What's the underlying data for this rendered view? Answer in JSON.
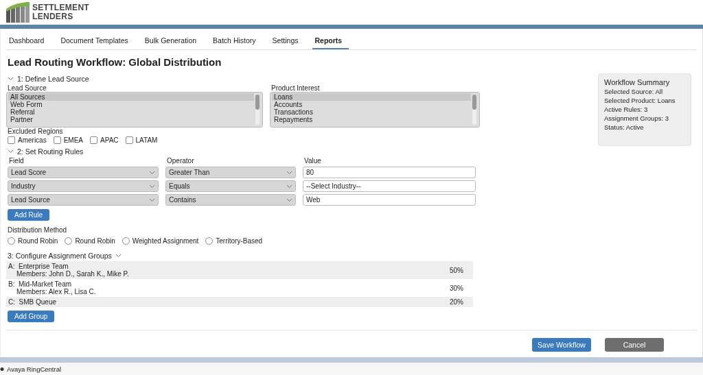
{
  "logo": {
    "line1": "SETTLEMENT",
    "line2": "LENDERS"
  },
  "tabs": [
    {
      "label": "Dashboard",
      "selected": false
    },
    {
      "label": "Document Templates",
      "selected": false
    },
    {
      "label": "Bulk Generation",
      "selected": false
    },
    {
      "label": "Batch History",
      "selected": false
    },
    {
      "label": "Settings",
      "selected": false
    },
    {
      "label": "Reports",
      "selected": true
    }
  ],
  "title": "Lead Routing Workflow: Global Distribution",
  "section_1": {
    "heading": "1: Define Lead Source",
    "lead_source": {
      "label": "Lead Source",
      "options": [
        {
          "label": "All Sources",
          "selected": true
        },
        {
          "label": "Web Form",
          "selected": false
        },
        {
          "label": "Referral",
          "selected": false
        },
        {
          "label": "Partner",
          "selected": false
        }
      ]
    },
    "product_interest": {
      "label": "Product Interest",
      "options": [
        {
          "label": "Loans",
          "selected": true
        },
        {
          "label": "Accounts",
          "selected": false
        },
        {
          "label": "Transactions",
          "selected": false
        },
        {
          "label": "Repayments",
          "selected": false
        }
      ]
    },
    "excluded_regions": {
      "label": "Excluded Regions",
      "options": [
        {
          "label": "Americas",
          "checked": false
        },
        {
          "label": "EMEA",
          "checked": false
        },
        {
          "label": "APAC",
          "checked": false
        },
        {
          "label": "LATAM",
          "checked": false
        }
      ]
    }
  },
  "section_2": {
    "heading": "2: Set Routing Rules",
    "columns": [
      "Field",
      "Operator",
      "Value"
    ],
    "rules": [
      {
        "field": "Lead Score",
        "operator": "Greater Than",
        "value": "80"
      },
      {
        "field": "Industry",
        "operator": "Equals",
        "value": "--Select Industry--"
      },
      {
        "field": "Lead Source",
        "operator": "Contains",
        "value": "Web"
      }
    ],
    "add_button": "Add Rule",
    "distribution": {
      "label": "Distribution Method",
      "options": [
        {
          "label": "Round Robin",
          "selected": false
        },
        {
          "label": "Round Robin",
          "selected": false
        },
        {
          "label": "Weighted Assignment",
          "selected": false
        },
        {
          "label": "Territory-Based",
          "selected": false
        }
      ]
    }
  },
  "section_3": {
    "heading": "3: Configure Assignment Groups",
    "groups": [
      {
        "letter": "A:",
        "name": "Enterprise Team",
        "members": "Members: John D., Sarah K., Mike P.",
        "share": "50%"
      },
      {
        "letter": "B:",
        "name": "Mid-Market Team",
        "members": "Members: Alex R., Lisa C.",
        "share": "30%"
      },
      {
        "letter": "C:",
        "name": "SMB Queue",
        "share": "20%"
      }
    ],
    "add_button": "Add Group"
  },
  "summary": {
    "title": "Workflow Summary",
    "lines": [
      "Selected Source: All",
      "Selected Product: Loans",
      "Active Rules: 3",
      "Assignment Groups: 3",
      "Status: Active"
    ]
  },
  "buttons": [
    {
      "label": "Save Workflow",
      "kind": "primary"
    },
    {
      "label": "Cancel",
      "kind": "secondary"
    }
  ],
  "footer": {
    "label": "Avaya RingCentral"
  }
}
